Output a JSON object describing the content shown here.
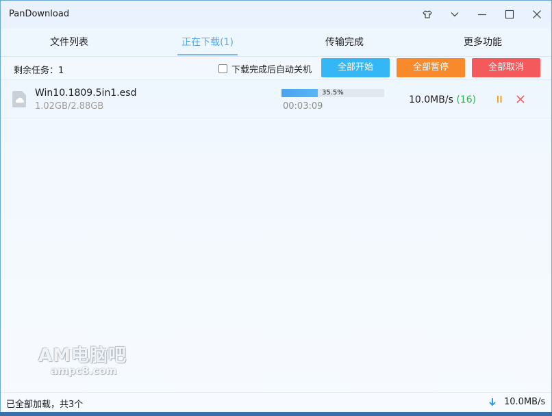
{
  "window": {
    "title": "PanDownload"
  },
  "title_buttons": [
    {
      "name": "skin-icon"
    },
    {
      "name": "dropdown-icon"
    },
    {
      "name": "minimize-icon"
    },
    {
      "name": "maximize-icon"
    },
    {
      "name": "close-icon"
    }
  ],
  "tabs": [
    {
      "label": "文件列表",
      "active": false
    },
    {
      "label": "正在下载(1)",
      "active": true
    },
    {
      "label": "传输完成",
      "active": false
    },
    {
      "label": "更多功能",
      "active": false
    }
  ],
  "toolbar": {
    "remaining": "剩余任务：1",
    "shutdown_label": "下载完成后自动关机",
    "shutdown_checked": false,
    "start_all": "全部开始",
    "pause_all": "全部暂停",
    "cancel_all": "全部取消",
    "colors": {
      "start": "#36b7f5",
      "pause": "#f98a2c",
      "cancel": "#f4595c"
    }
  },
  "downloads": [
    {
      "file_name": "Win10.1809.5in1.esd",
      "size": "1.02GB/2.88GB",
      "progress_percent": 35.5,
      "progress_label": "35.5%",
      "elapsed": "00:03:09",
      "speed": "10.0MB/s",
      "connections": "(16)"
    }
  ],
  "watermark": {
    "line1": "AM电脑吧",
    "line2": "ampc8.com"
  },
  "status": {
    "left": "已全部加载，共3个",
    "speed": "10.0MB/s"
  }
}
